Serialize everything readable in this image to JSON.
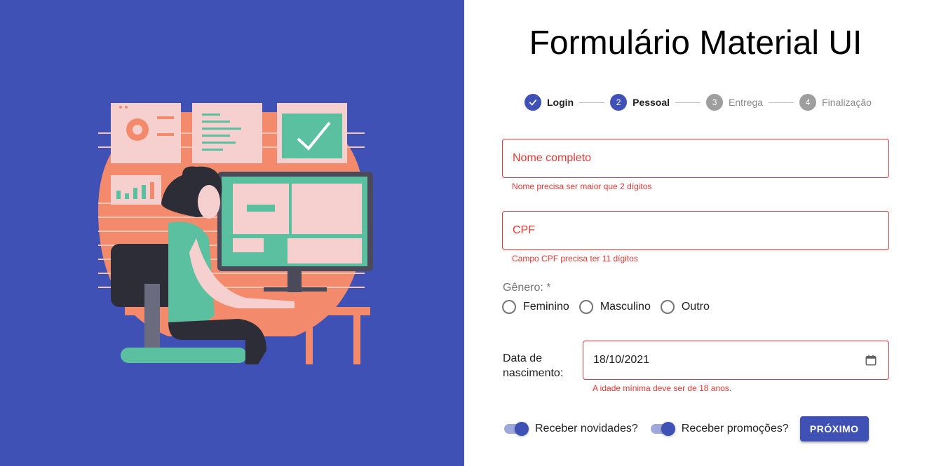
{
  "title": "Formulário Material UI",
  "stepper": {
    "steps": [
      {
        "number": "",
        "label": "Login"
      },
      {
        "number": "2",
        "label": "Pessoal"
      },
      {
        "number": "3",
        "label": "Entrega"
      },
      {
        "number": "4",
        "label": "Finalização"
      }
    ]
  },
  "form": {
    "name": {
      "placeholder": "Nome completo",
      "helper": "Nome precisa ser maior que 2 dígitos"
    },
    "cpf": {
      "placeholder": "CPF",
      "helper": "Campo CPF precisa ter 11 dígitos"
    },
    "gender": {
      "label": "Gênero: *",
      "options": [
        "Feminino",
        "Masculino",
        "Outro"
      ]
    },
    "birthdate": {
      "label": "Data de nascimento:",
      "value": "18/10/2021",
      "helper": "A idade mínima deve ser de 18 anos."
    },
    "switches": [
      "Receber novidades?",
      "Receber promoções?"
    ],
    "next_label": "PRÓXIMO"
  },
  "colors": {
    "primary": "#3f51b5",
    "error": "#e53935",
    "illustration_bg": "#3f51b5",
    "coral": "#f48a6c",
    "teal": "#5bc0a0"
  }
}
